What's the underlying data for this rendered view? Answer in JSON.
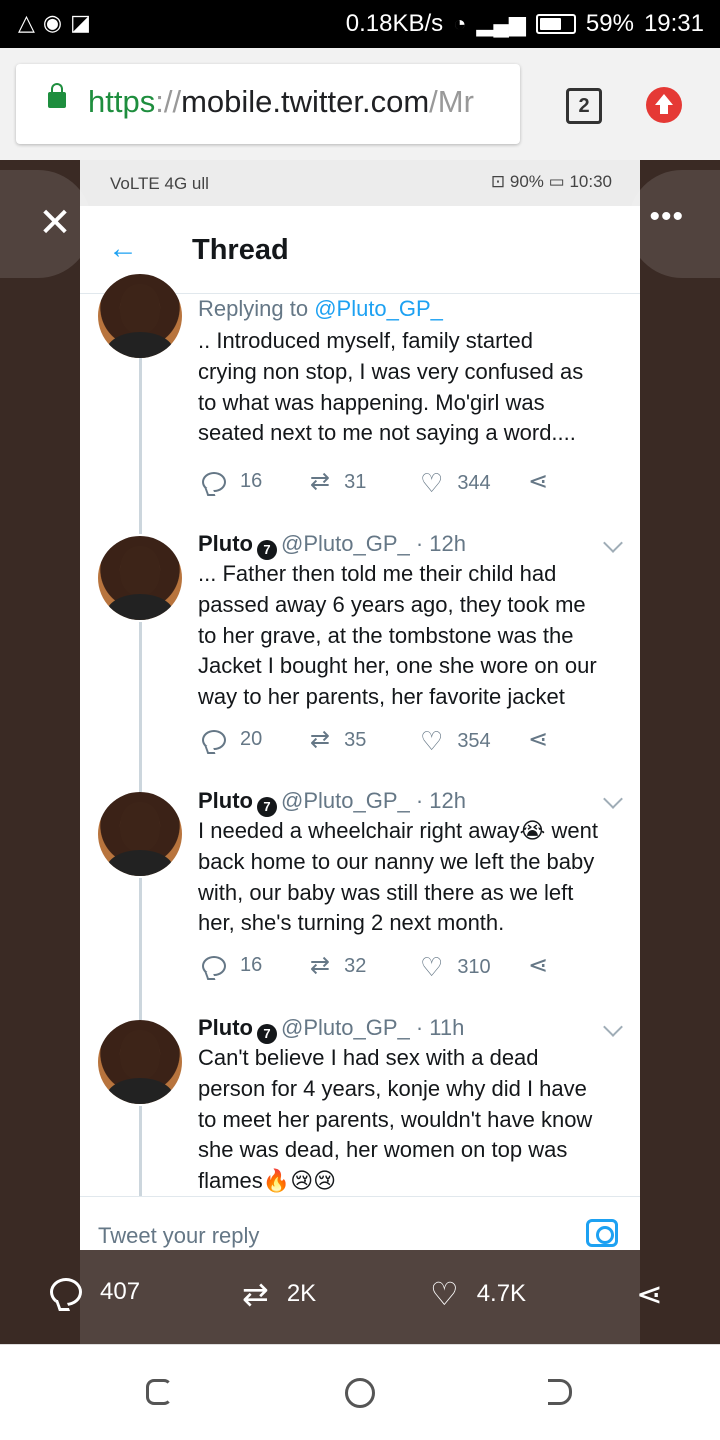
{
  "outer_status": {
    "left_icons": [
      "warning-icon",
      "location-icon",
      "screenshot-icon"
    ],
    "speed": "0.18KB/s",
    "battery": "59%",
    "time": "19:31"
  },
  "browser": {
    "url_scheme": "https",
    "url_sep": "://",
    "url_host": "mobile.twitter.com",
    "url_path": "/Mr",
    "tab_count": "2"
  },
  "inner_status": {
    "left": "VoLTE 4G ull",
    "right_battery": "90%",
    "time": "10:30"
  },
  "thread": {
    "title": "Thread",
    "reply_placeholder": "Tweet your reply",
    "tweets": [
      {
        "reply_prefix": "Replying to ",
        "reply_mention": "@Pluto_GP_",
        "text": ".. Introduced myself, family started\ncrying non stop, I was very confused as\nto what was happening. Mo'girl was\nseated next to me not saying a word....",
        "replies": "16",
        "retweets": "31",
        "likes": "344"
      },
      {
        "name": "Pluto",
        "handle": "@Pluto_GP_",
        "time": "· 12h",
        "text": "... Father then told me their child had\npassed away 6 years ago, they took me\nto her grave, at the tombstone was the\nJacket I bought her, one she wore on our\nway to her parents, her favorite jacket",
        "replies": "20",
        "retweets": "35",
        "likes": "354"
      },
      {
        "name": "Pluto",
        "handle": "@Pluto_GP_",
        "time": "· 12h",
        "text": "I needed a wheelchair right away😭 went\nback home to our nanny we left the baby\nwith, our baby was still there as we left\nher, she's turning 2 next month.",
        "replies": "16",
        "retweets": "32",
        "likes": "310"
      },
      {
        "name": "Pluto",
        "handle": "@Pluto_GP_",
        "time": "· 11h",
        "text": "Can't believe I had sex with a dead\nperson for 4 years, konje why did I have\nto meet her parents, wouldn't have know\nshe was dead, her women on top was\nflames🔥😢😢"
      }
    ]
  },
  "viewer_stats": {
    "replies": "407",
    "retweets": "2K",
    "likes": "4.7K"
  },
  "colors": {
    "twitter_blue": "#1da1f2",
    "secure_green": "#1e8e3e",
    "viewer_bg": "#3a2a24"
  }
}
